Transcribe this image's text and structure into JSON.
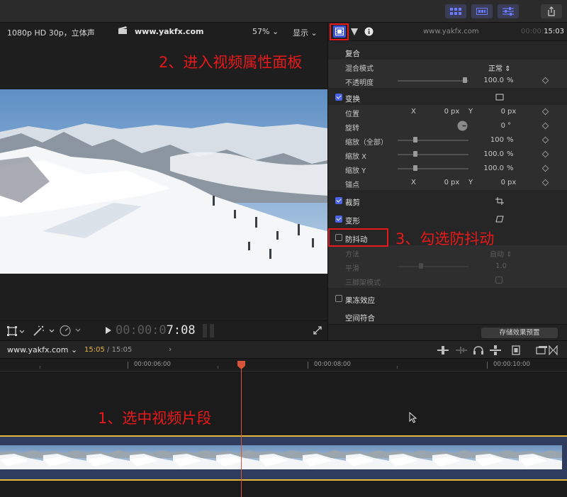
{
  "viewer": {
    "format": "1080p HD 30p，立体声",
    "title": "www.yakfx.com",
    "zoom": "57%",
    "display": "显示",
    "timecode_dim": "00:00:0",
    "timecode_bright": "7:08"
  },
  "inspector": {
    "header_title": "www.yakfx.com",
    "header_tc_dim": "00:00:",
    "header_tc": "15:03",
    "sections": {
      "composite": "复合",
      "blend_mode": "混合模式",
      "blend_mode_value": "正常",
      "opacity": "不透明度",
      "opacity_value": "100.0",
      "opacity_unit": "%",
      "transform": "变换",
      "position": "位置",
      "x": "X",
      "y": "Y",
      "pos_x_val": "0",
      "pos_y_val": "0",
      "px": "px",
      "rotation": "旋转",
      "rotation_val": "0",
      "deg": "°",
      "scale_all": "缩放（全部）",
      "scale_all_val": "100",
      "scale_x": "缩放 X",
      "scale_x_val": "100.0",
      "scale_y": "缩放 Y",
      "scale_y_val": "100.0",
      "anchor": "锚点",
      "anchor_x_val": "0",
      "anchor_y_val": "0",
      "crop": "裁剪",
      "distort": "变形",
      "stabilization": "防抖动",
      "method": "方法",
      "method_value": "自动",
      "smoothing": "平滑",
      "smoothing_val": "1.0",
      "tripod": "三脚架模式",
      "rolling_shutter": "果冻效应",
      "spatial_conform": "空间符合"
    },
    "save_preset": "存储效果预置"
  },
  "timeline": {
    "project": "www.yakfx.com",
    "tc_current": "15:05",
    "tc_total": "/ 15:05",
    "ruler": [
      "00:00:06:00",
      "00:00:08:00",
      "00:00:10:00"
    ]
  },
  "annotations": {
    "step1": "1、选中视频片段",
    "step2": "2、进入视频属性面板",
    "step3": "3、勾选防抖动"
  },
  "colors": {
    "accent": "#4a63e8",
    "annotation": "#e8191a",
    "playhead": "#d9553a",
    "clip_border": "#e2b63a"
  }
}
